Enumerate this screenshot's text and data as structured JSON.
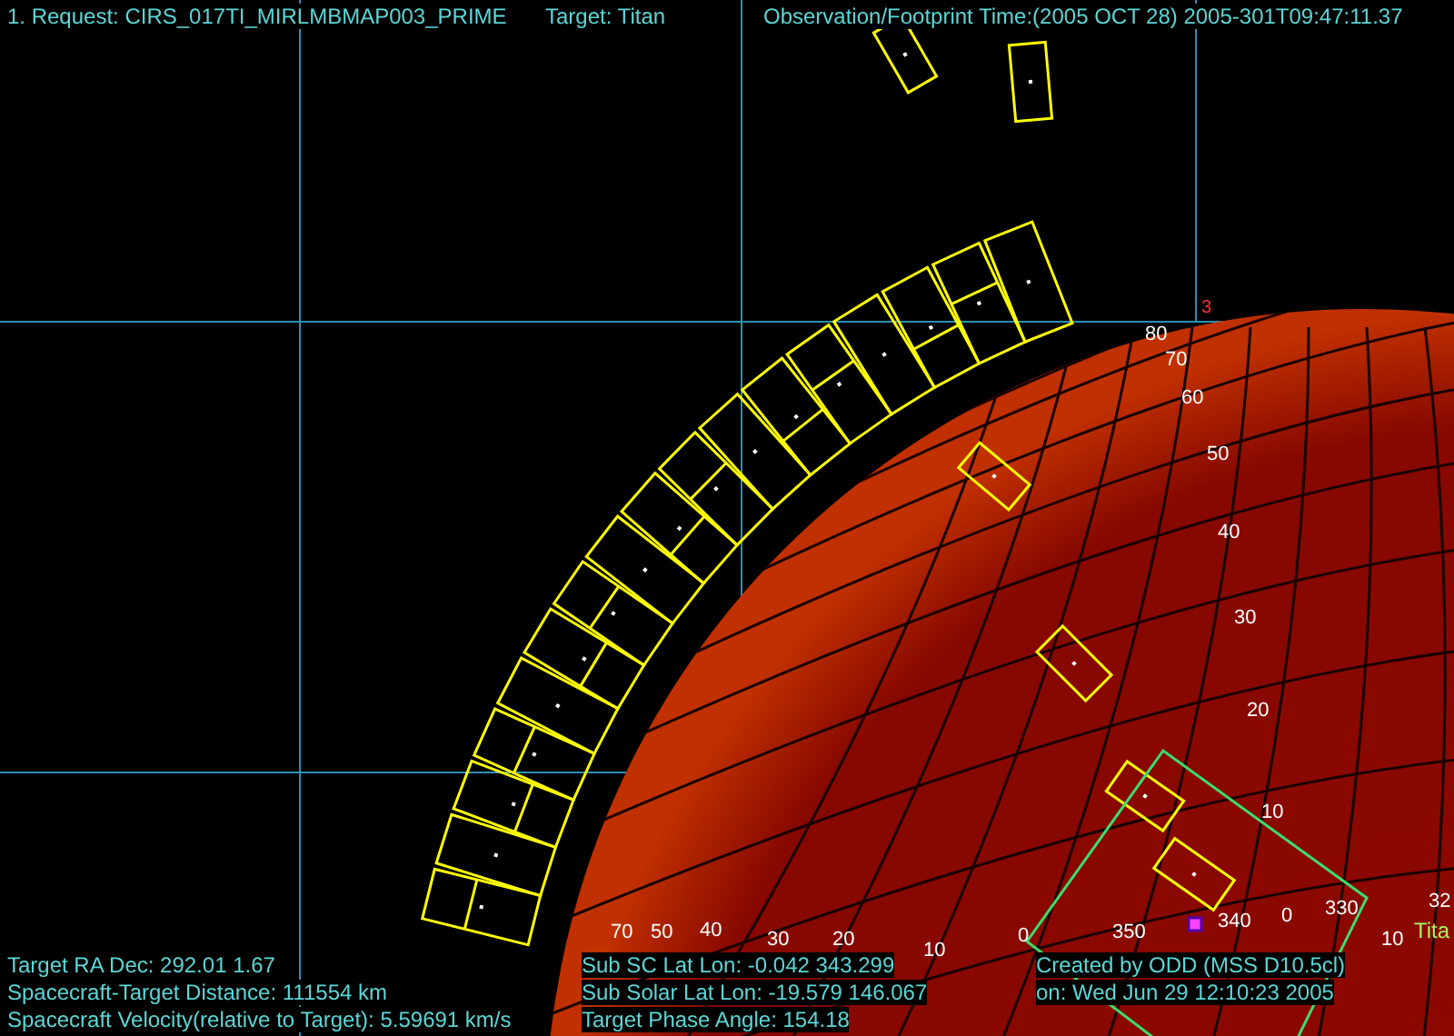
{
  "header": {
    "request": "1. Request:  CIRS_017TI_MIRLMBMAP003_PRIME",
    "target": "Target: Titan",
    "time": "Observation/Footprint Time:(2005 OCT 28)  2005-301T09:47:11.37"
  },
  "corner_mark": "3",
  "lat_labels": [
    "80",
    "70",
    "60",
    "50",
    "40",
    "30",
    "20",
    "10"
  ],
  "lon_labels": [
    "70",
    "50",
    "40",
    "30",
    "20",
    "10",
    "0",
    "350",
    "340",
    "0",
    "330",
    "32",
    "10"
  ],
  "body_label": "Tita",
  "footer_left": [
    "Target RA  Dec: 292.01    1.67",
    "Spacecraft-Target Distance:  111554 km",
    "Spacecraft Velocity(relative to Target): 5.59691 km/s"
  ],
  "footer_center": [
    "Sub SC Lat Lon: -0.042  343.299",
    "Sub Solar Lat Lon: -19.579  146.067",
    "Target Phase Angle: 154.18"
  ],
  "footer_right": [
    "Created by ODD (MSS D10.5cl)",
    "on: Wed Jun 29 12:10:23 2005"
  ]
}
